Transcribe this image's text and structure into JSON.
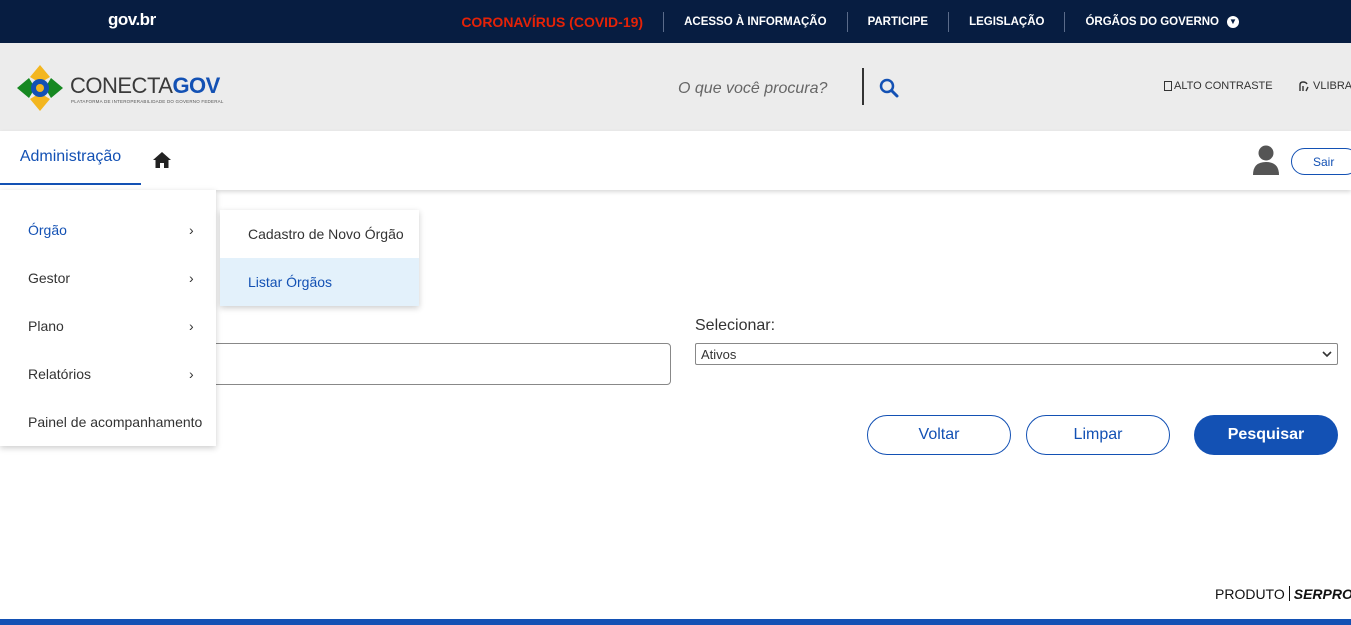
{
  "topbar": {
    "logo_text": "gov.br",
    "links": [
      "CORONAVÍRUS (COVID-19)",
      "ACESSO À INFORMAÇÃO",
      "PARTICIPE",
      "LEGISLAÇÃO",
      "ÓRGÃOS DO GOVERNO"
    ]
  },
  "header": {
    "brand_prefix": "CONECTA",
    "brand_suffix": "GOV",
    "brand_subtitle": "PLATAFORMA DE INTEROPERABILIDADE DO GOVERNO FEDERAL",
    "search_placeholder": "O que você procura?",
    "contrast_label": "ALTO CONTRASTE",
    "vlibras_label": "VLIBRAS"
  },
  "nav": {
    "admin_label": "Administração",
    "logout_label": "Sair"
  },
  "menu": {
    "items": [
      "Órgão",
      "Gestor",
      "Plano",
      "Relatórios",
      "Painel de acompanhamento"
    ]
  },
  "submenu": {
    "items": [
      "Cadastro de Novo Órgão",
      "Listar Órgãos"
    ]
  },
  "form": {
    "select_label": "Selecionar:",
    "select_value": "Ativos",
    "buttons": {
      "back": "Voltar",
      "clear": "Limpar",
      "search": "Pesquisar"
    }
  },
  "footer": {
    "product_label": "PRODUTO",
    "company": "SERPRO"
  },
  "colors": {
    "topbar_bg": "#071d41",
    "accent": "#1351b4",
    "covid_red": "#e52207",
    "header_bg": "#ececec",
    "highlight_bg": "#e3f1fb"
  },
  "icons": [
    "search-icon",
    "home-icon",
    "user-icon",
    "chevron-right-icon",
    "chevron-down-icon",
    "contrast-icon",
    "vlibras-hand-icon"
  ]
}
